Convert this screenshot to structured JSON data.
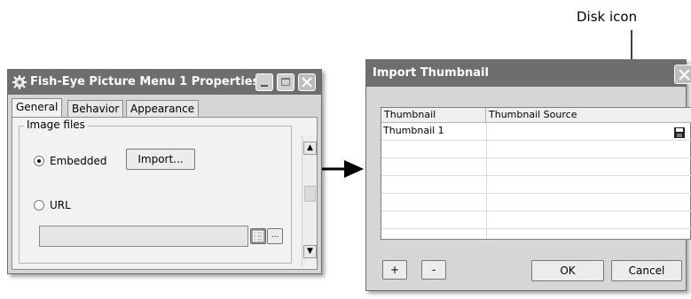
{
  "properties_window": {
    "title": "Fish-Eye Picture Menu 1 Properties",
    "tabs": [
      "General",
      "Behavior",
      "Appearance"
    ],
    "group_label": "Image files",
    "radio_embedded": "Embedded",
    "import_button": "Import...",
    "radio_url": "URL",
    "url_value": "",
    "browse_button": "..."
  },
  "import_window": {
    "title": "Import Thumbnail",
    "columns": [
      "Thumbnail",
      "Thumbnail Source"
    ],
    "rows": [
      {
        "thumbnail": "Thumbnail 1",
        "source": ""
      }
    ],
    "add_button": "+",
    "remove_button": "-",
    "ok_button": "OK",
    "cancel_button": "Cancel"
  },
  "annotation": {
    "label": "Disk icon"
  },
  "colors": {
    "titlebar": "#6e6e6e",
    "window_bg": "#d6d6d6",
    "panel_bg": "#f2f2f2"
  }
}
